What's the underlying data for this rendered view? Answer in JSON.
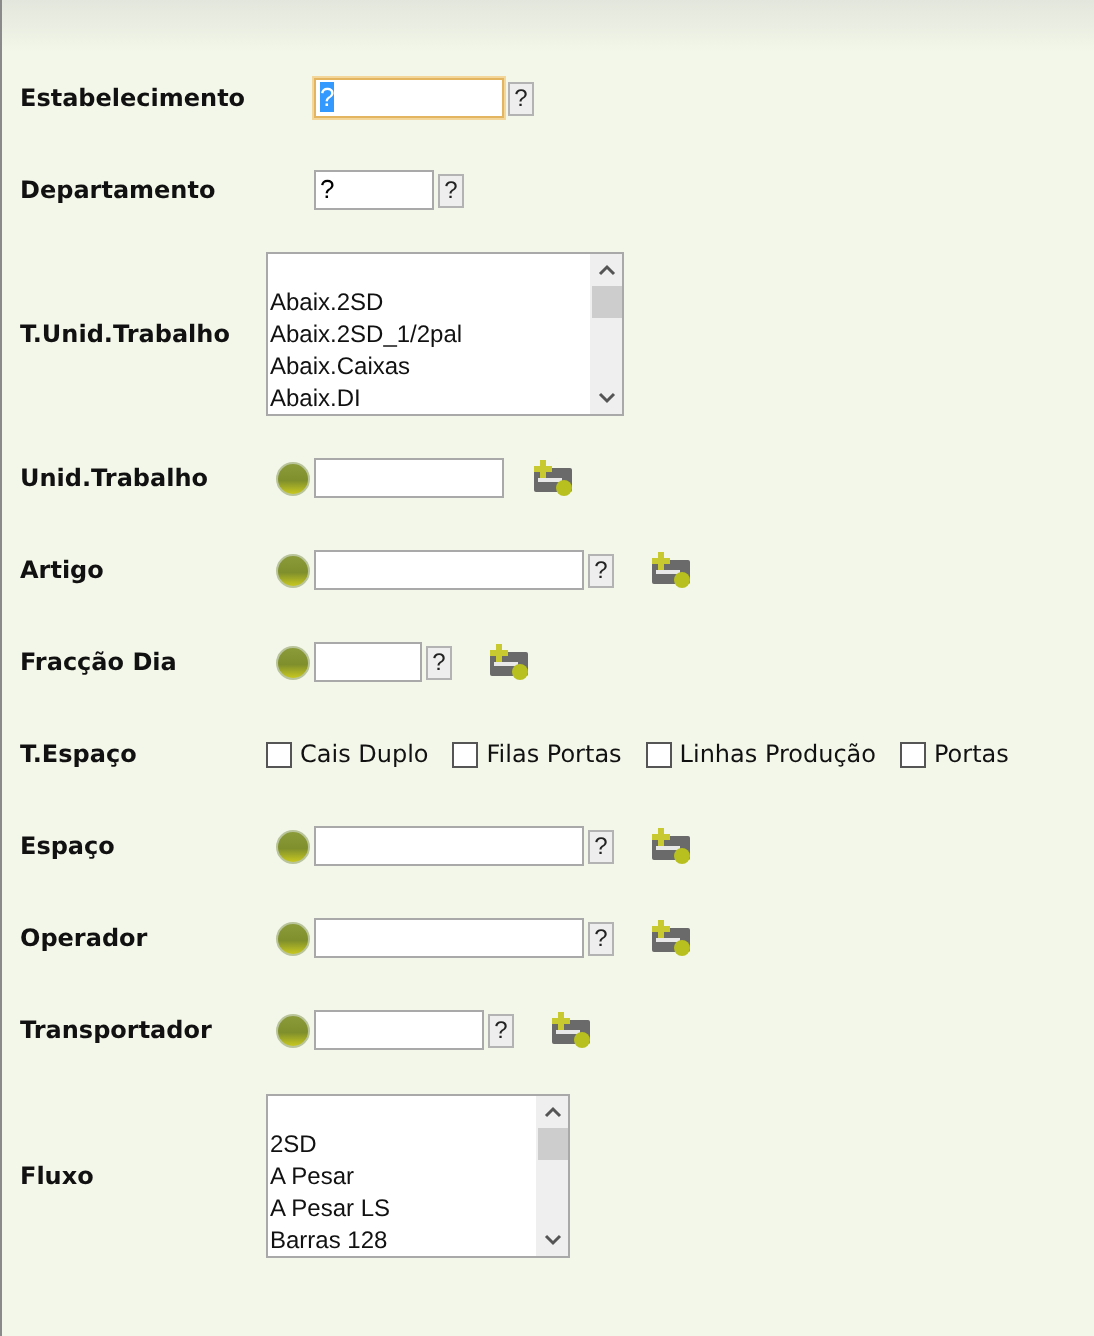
{
  "fields": [
    {
      "kind": "text",
      "label": "Estabelecimento",
      "value": "?",
      "focused": true,
      "help": "?"
    },
    {
      "kind": "text",
      "label": "Departamento",
      "value": "?",
      "focused": false,
      "help": "?"
    },
    {
      "kind": "listbox",
      "label": "T.Unid.Trabalho",
      "options": [
        "Abaix.2SD",
        "Abaix.2SD_1/2pal",
        "Abaix.Caixas",
        "Abaix.DI"
      ]
    },
    {
      "kind": "lookup",
      "label": "Unid.Trabalho"
    },
    {
      "kind": "lookup",
      "label": "Artigo",
      "help": "?"
    },
    {
      "kind": "lookup",
      "label": "Fracção Dia",
      "help": "?"
    },
    {
      "kind": "checkboxes",
      "label": "T.Espaço",
      "options": [
        {
          "label": "Cais Duplo",
          "checked": false
        },
        {
          "label": "Filas Portas",
          "checked": false
        },
        {
          "label": "Linhas Produção",
          "checked": false
        },
        {
          "label": "Portas",
          "checked": false
        }
      ]
    },
    {
      "kind": "lookup",
      "label": "Espaço",
      "help": "?"
    },
    {
      "kind": "lookup",
      "label": "Operador",
      "help": "?"
    },
    {
      "kind": "lookup",
      "label": "Transportador",
      "help": "?"
    },
    {
      "kind": "listbox",
      "label": "Fluxo",
      "options": [
        "2SD",
        "A Pesar",
        "A Pesar LS",
        "Barras 128"
      ]
    }
  ]
}
